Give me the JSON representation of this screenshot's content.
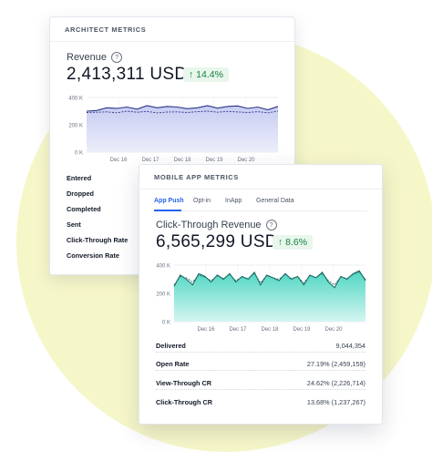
{
  "architect": {
    "header": "ARCHITECT METRICS",
    "metric_title": "Revenue",
    "value": "2,413,311 USD",
    "delta": "14.4%",
    "rows": [
      "Entered",
      "Dropped",
      "Completed",
      "Sent",
      "Click-Through Rate",
      "Conversion Rate"
    ],
    "chart_data": {
      "type": "area",
      "title": "",
      "x_ticks": [
        "Dec 16",
        "Dec 17",
        "Dec 18",
        "Dec 19",
        "Dec 20"
      ],
      "y_ticks": [
        "400 K",
        "200 K",
        "0 K"
      ],
      "ylim": [
        0,
        400000
      ],
      "series": [
        {
          "values": [
            300000,
            305000,
            325000,
            320000,
            330000,
            315000,
            340000,
            325000,
            335000,
            330000,
            318000,
            325000,
            340000,
            322000,
            335000,
            338000,
            320000,
            330000,
            310000,
            335000
          ]
        },
        {
          "values": [
            290000,
            292000,
            295000,
            288000,
            300000,
            292000,
            298000,
            287000,
            293000,
            295000,
            290000,
            296000,
            300000,
            292000,
            298000,
            294000,
            290000,
            296000,
            288000,
            300000
          ]
        }
      ],
      "colors": {
        "fill": "#c7ccf3",
        "line": "#2c3585"
      }
    }
  },
  "mobile": {
    "header": "MOBILE APP METRICS",
    "tabs": [
      "App Push",
      "Opt-in",
      "InApp",
      "General Data"
    ],
    "active_tab": "App Push",
    "metric_title": "Click-Through Revenue",
    "value": "6,565,299 USD",
    "delta": "8.6%",
    "rows": [
      {
        "label": "Delivered",
        "value": "9,044,354"
      },
      {
        "label": "Open Rate",
        "value": "27.19% (2,459,159)"
      },
      {
        "label": "View-Through CR",
        "value": "24.62% (2,226,714)"
      },
      {
        "label": "Click-Through CR",
        "value": "13.68% (1,237,267)"
      }
    ],
    "chart_data": {
      "type": "area",
      "title": "",
      "x_ticks": [
        "Dec 16",
        "Dec 17",
        "Dec 18",
        "Dec 19",
        "Dec 20"
      ],
      "y_ticks": [
        "400 K",
        "200 K",
        "0 K"
      ],
      "ylim": [
        0,
        400000
      ],
      "series": [
        {
          "values": [
            250000,
            330000,
            300000,
            260000,
            340000,
            320000,
            280000,
            330000,
            300000,
            340000,
            280000,
            320000,
            300000,
            350000,
            260000,
            330000,
            310000,
            290000,
            340000,
            300000,
            320000,
            260000,
            330000,
            310000,
            350000,
            280000,
            240000,
            320000,
            300000,
            340000,
            360000,
            290000
          ]
        },
        {
          "values": [
            260000,
            320000,
            310000,
            280000,
            330000,
            315000,
            290000,
            325000,
            305000,
            335000,
            290000,
            315000,
            305000,
            340000,
            275000,
            325000,
            310000,
            300000,
            335000,
            305000,
            318000,
            275000,
            325000,
            312000,
            340000,
            290000,
            260000,
            318000,
            305000,
            335000,
            350000,
            300000
          ]
        }
      ],
      "colors": {
        "fill_top": "#4fd6c3",
        "fill_bottom": "#d5f6f1",
        "line": "#1e6d64"
      }
    }
  }
}
